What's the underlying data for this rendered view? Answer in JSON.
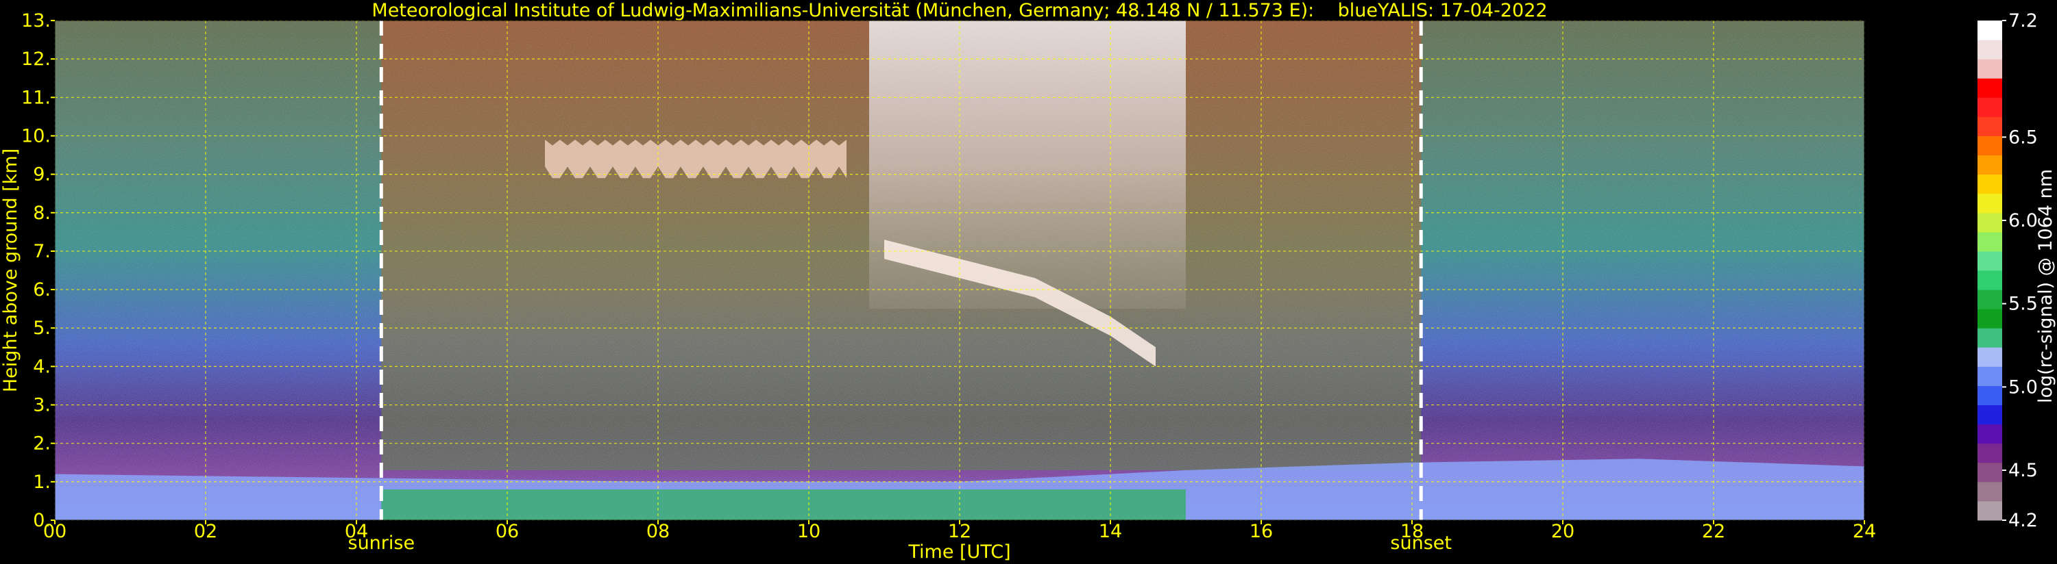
{
  "chart_data": {
    "type": "heatmap",
    "title": "Meteorological Institute of Ludwig-Maximilians-Universität (München, Germany; 48.148 N / 11.573 E):    blueYALIS: 17-04-2022",
    "xlabel": "Time [UTC]",
    "ylabel": "Height above ground [km]",
    "xlim": [
      0,
      24
    ],
    "ylim": [
      0,
      13
    ],
    "x_ticks": [
      0,
      2,
      4,
      6,
      8,
      10,
      12,
      14,
      16,
      18,
      20,
      22,
      24
    ],
    "x_tick_labels": [
      "00",
      "02",
      "04",
      "06",
      "08",
      "10",
      "12",
      "14",
      "16",
      "18",
      "20",
      "22",
      "24"
    ],
    "y_ticks": [
      0,
      1,
      2,
      3,
      4,
      5,
      6,
      7,
      8,
      9,
      10,
      11,
      12,
      13
    ],
    "y_tick_labels": [
      "0.",
      "1.",
      "2.",
      "3.",
      "4.",
      "5.",
      "6.",
      "7.",
      "8.",
      "9.",
      "10.",
      "11.",
      "12.",
      "13."
    ],
    "grid": true,
    "grid_color": "#ffff00",
    "annotations": [
      {
        "label": "sunrise",
        "x": 4.33
      },
      {
        "label": "sunset",
        "x": 18.12
      }
    ],
    "colorbar": {
      "label": "log(rc-signal) @ 1064 nm",
      "range": [
        4.2,
        7.2
      ],
      "ticks": [
        4.2,
        4.5,
        5.0,
        5.5,
        6.0,
        6.5,
        7.2
      ],
      "tick_labels": [
        "4.2",
        "4.5",
        "5.0",
        "5.5",
        "6.0",
        "6.5",
        "7.2"
      ],
      "levels": [
        "#b0a0a8",
        "#9b7a8f",
        "#8b4f86",
        "#7a2a8f",
        "#5a10b0",
        "#2020e0",
        "#3a5cf0",
        "#6f8ef5",
        "#a8baf8",
        "#40c080",
        "#10a020",
        "#20b040",
        "#30d070",
        "#60e090",
        "#90ee60",
        "#c8f040",
        "#f0f020",
        "#ffd000",
        "#ffa000",
        "#ff7000",
        "#ff4020",
        "#ff2020",
        "#ff0000",
        "#f0c0c0",
        "#f0e0e0",
        "#ffffff"
      ]
    },
    "features": {
      "boundary_layer_top_km": {
        "x": [
          0,
          4,
          8,
          12,
          15,
          18,
          21,
          24
        ],
        "y": [
          1.2,
          1.1,
          1.0,
          1.0,
          1.3,
          1.5,
          1.6,
          1.4
        ]
      },
      "cirrus_layer_km": {
        "x_range": [
          6.5,
          10.5
        ],
        "y_range": [
          8.8,
          9.9
        ]
      },
      "descending_cloud_base_km": {
        "x": [
          11.0,
          12.0,
          13.0,
          14.0,
          14.6
        ],
        "y": [
          6.8,
          6.3,
          5.8,
          4.8,
          4.0
        ]
      },
      "bright_daylight_column": {
        "x_range": [
          10.8,
          15.0
        ]
      }
    }
  }
}
